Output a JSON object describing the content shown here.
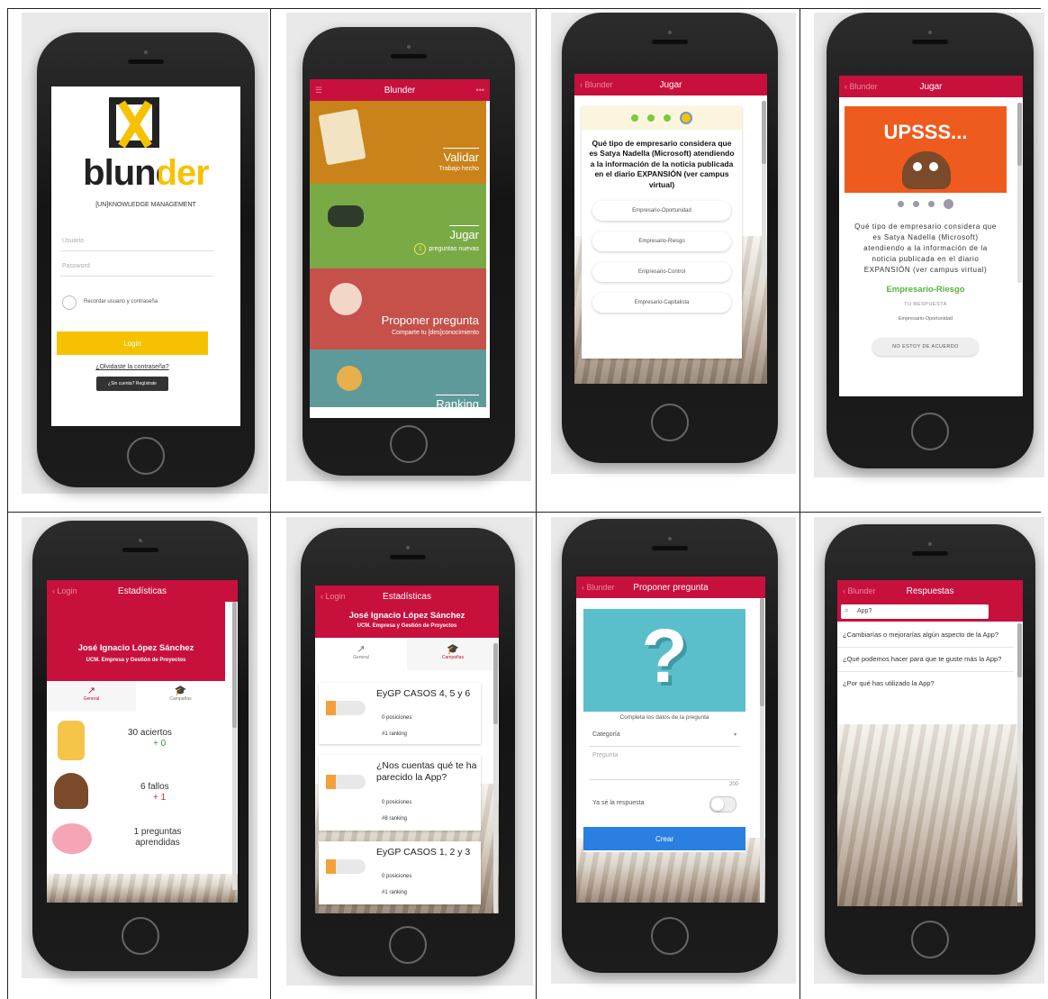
{
  "login": {
    "brand": "blunder",
    "tagline": "[UN]KNOWLEDGE MANAGEMENT",
    "username_placeholder": "Usuario",
    "password_placeholder": "Password",
    "remember_label": "Recordar usuario y contraseña",
    "login_button": "Login",
    "forgot_link": "¿Olvidaste la contraseña?",
    "register_button": "¿Sin cuenta? Regístrate"
  },
  "menu": {
    "title": "Blunder",
    "cards": [
      {
        "title": "Validar",
        "subtitle": "Trabajo hecho",
        "color": "#c9831a"
      },
      {
        "title": "Jugar",
        "subtitle": "preguntas nuevas",
        "badge": "1",
        "color": "#7aaa46"
      },
      {
        "title": "Proponer pregunta",
        "subtitle": "Comparte tu [des]conocimiento",
        "color": "#c6504a"
      },
      {
        "title": "Ranking",
        "subtitle": "",
        "color": "#5f9a9a"
      }
    ]
  },
  "quiz": {
    "title": "Jugar",
    "question": "Qué tipo de empresario considera que es Satya Nadella (Microsoft) atendiendo a la información de la noticia publicada en el diario EXPANSIÓN (ver campus virtual)",
    "options": [
      "Empresario-Oportunidad",
      "Empresario-Riesgo",
      "Empresario-Control",
      "Empresario-Capitalista"
    ]
  },
  "result": {
    "title": "Jugar",
    "banner": "UPSSS...",
    "question": "Qué tipo de empresario considera que es Satya Nadella (Microsoft) atendiendo a la información de la noticia publicada en el diario EXPANSIÓN (ver campus virtual)",
    "correct": "Empresario-Riesgo",
    "your_answer_label": "TU RESPUESTA",
    "your_answer": "Empresario-Oportunidad",
    "disagree_button": "NO ESTOY DE ACUERDO"
  },
  "stats": {
    "title": "Estadísticas",
    "user": "José Ignacio López Sánchez",
    "org": "UCM. Empresa y Gestión de Proyectos",
    "tab_general": "General",
    "tab_campaigns": "Campañas",
    "rows": [
      {
        "main": "30 aciertos",
        "delta": "+ 0",
        "delta_color": "#2e9e3a"
      },
      {
        "main": "6 fallos",
        "delta": "+ 1",
        "delta_color": "#d0243c"
      },
      {
        "main": "1 preguntas aprendidas",
        "delta": "",
        "delta_color": "#333333"
      }
    ]
  },
  "campaigns": {
    "title": "Estadísticas",
    "user": "José Ignacio López Sánchez",
    "org": "UCM. Empresa y Gestión de Proyectos",
    "tab_general": "General",
    "tab_campaigns": "Campañas",
    "items": [
      {
        "name": "EyGP CASOS 4, 5 y 6",
        "positions": "0 posiciones",
        "ranking": "#1 ranking"
      },
      {
        "name": "¿Nos cuentas qué te ha parecido la App?",
        "positions": "0 posiciones",
        "ranking": "#8 ranking"
      },
      {
        "name": "EyGP CASOS 1, 2 y 3",
        "positions": "0 posiciones",
        "ranking": "#1 ranking"
      }
    ]
  },
  "propose": {
    "title": "Proponer pregunta",
    "hint": "Completa los datos de la pregunta",
    "category_label": "Categoría",
    "question_placeholder": "Pregunta",
    "counter": "200",
    "toggle_label": "Ya sé la respuesta",
    "create_button": "Crear"
  },
  "answers": {
    "title": "Respuestas",
    "search_value": "App?",
    "items": [
      "¿Cambiarías o mejorarías algún aspecto de la App?",
      "¿Qué podemos hacer para que te guste más la App?",
      "¿Por qué has utilizado la App?"
    ]
  }
}
